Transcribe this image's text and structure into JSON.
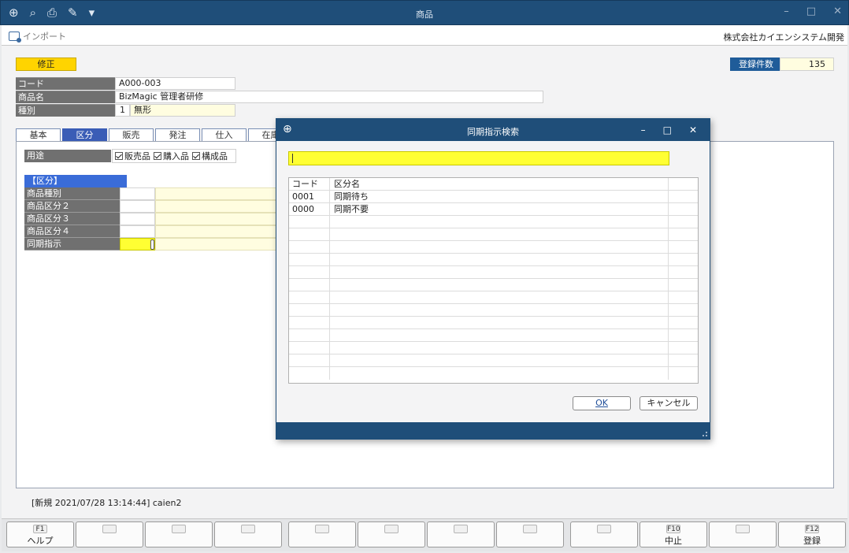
{
  "window": {
    "title": "商品",
    "tools": [
      "key-plus-icon",
      "preview-icon",
      "print-icon",
      "pen-icon",
      "dropdown-icon"
    ],
    "controls": [
      "minimize-icon",
      "maximize-icon",
      "close-icon"
    ]
  },
  "menubar": {
    "import_label": "インポート",
    "company": "株式会社カイエンシステム開発"
  },
  "header": {
    "mode": "修正",
    "count_label": "登録件数",
    "count_value": "135"
  },
  "fields": {
    "code": {
      "label": "コード",
      "value": "A000-003"
    },
    "name": {
      "label": "商品名",
      "value": "BizMagic 管理者研修"
    },
    "kind": {
      "label": "種別",
      "code": "1",
      "value": "無形"
    }
  },
  "tabs": [
    {
      "label": "基本",
      "active": false
    },
    {
      "label": "区分",
      "active": true
    },
    {
      "label": "販売",
      "active": false
    },
    {
      "label": "発注",
      "active": false
    },
    {
      "label": "仕入",
      "active": false
    },
    {
      "label": "在庫",
      "active": false
    }
  ],
  "usage": {
    "label": "用途",
    "options": [
      {
        "label": "販売品",
        "checked": true
      },
      {
        "label": "購入品",
        "checked": true
      },
      {
        "label": "構成品",
        "checked": true
      }
    ]
  },
  "classification": {
    "heading": "【区分】",
    "rows": [
      {
        "label": "商品種別"
      },
      {
        "label": "商品区分２"
      },
      {
        "label": "商品区分３"
      },
      {
        "label": "商品区分４"
      },
      {
        "label": "同期指示"
      }
    ]
  },
  "status": {
    "text": "[新規 2021/07/28 13:14:44] caien2"
  },
  "fkeys": [
    {
      "num": "F1",
      "label": "ヘルプ"
    },
    {
      "num": "",
      "label": ""
    },
    {
      "num": "",
      "label": ""
    },
    {
      "num": "",
      "label": ""
    },
    {
      "num": "",
      "label": ""
    },
    {
      "num": "",
      "label": ""
    },
    {
      "num": "",
      "label": ""
    },
    {
      "num": "",
      "label": ""
    },
    {
      "num": "",
      "label": ""
    },
    {
      "num": "F10",
      "label": "中止"
    },
    {
      "num": "",
      "label": ""
    },
    {
      "num": "F12",
      "label": "登録"
    }
  ],
  "dialog": {
    "title": "同期指示検索",
    "search_value": "",
    "columns": [
      "コード",
      "区分名"
    ],
    "rows": [
      {
        "code": "0001",
        "name": "同期待ち"
      },
      {
        "code": "0000",
        "name": "同期不要"
      }
    ],
    "ok_label": "OK",
    "cancel_label": "キャンセル"
  },
  "colors": {
    "title_bar": "#1f4e79",
    "mode_badge": "#ffd400",
    "active_tab": "#3a5db6",
    "focus_field": "#ffff33",
    "section_head": "#3a6cd8"
  }
}
